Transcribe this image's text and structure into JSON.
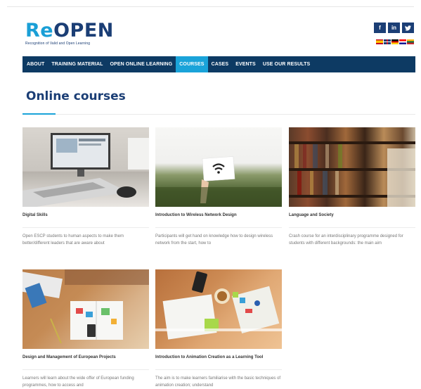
{
  "header": {
    "logo_re": "Re",
    "logo_open": "OPEN",
    "logo_subtitle": "Recognition of Valid and Open Learning",
    "social": [
      {
        "icon": "facebook-icon",
        "glyph": "f"
      },
      {
        "icon": "linkedin-icon",
        "glyph": "in"
      },
      {
        "icon": "twitter-icon",
        "glyph": "✈"
      }
    ],
    "languages": [
      "es",
      "gb",
      "de",
      "hr",
      "lt"
    ]
  },
  "nav": {
    "items": [
      {
        "label": "ABOUT"
      },
      {
        "label": "TRAINING MATERIAL"
      },
      {
        "label": "OPEN ONLINE LEARNING"
      },
      {
        "label": "COURSES",
        "active": true
      },
      {
        "label": "CASES"
      },
      {
        "label": "EVENTS"
      },
      {
        "label": "USE OUR RESULTS"
      }
    ]
  },
  "page": {
    "title": "Online courses"
  },
  "courses": [
    {
      "title": "Digital Skills",
      "description": "Open ESCP students to human aspects to make them better/different leaders that are aware about"
    },
    {
      "title": "Introduction to Wireless Network Design",
      "description": "Participants will get hand on knowledge how to design wireless network from the start, how to"
    },
    {
      "title": "Language and Society",
      "description": "Crash course for an interdisciplinary programme designed for students with different backgrounds: the main aim"
    },
    {
      "title": "Design and Management of European Projects",
      "description": "Learners will learn about the wide offer of European funding programmes, how to access and"
    },
    {
      "title": "Introduction to Animation Creation as a Learning Tool",
      "description": "The aim is to make learners familiarise with the basic techniques of animation creation; understand"
    }
  ],
  "colors": {
    "brand_dark": "#1b3e75",
    "brand_light": "#1aa3d9",
    "nav_bg": "#0d3a63"
  }
}
